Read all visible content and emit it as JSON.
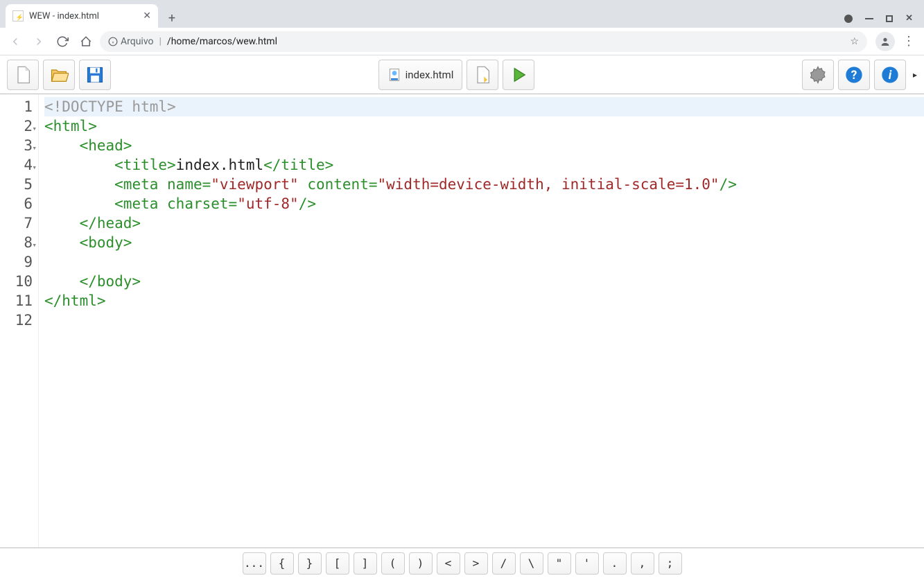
{
  "window": {
    "tab_title": "WEW - index.html"
  },
  "browser": {
    "address_label": "Arquivo",
    "address_path": "/home/marcos/wew.html"
  },
  "app": {
    "open_doc_label": "index.html"
  },
  "code": {
    "lines": [
      {
        "n": "1",
        "fold": false,
        "html": "<span class='t-decl'>&lt;!DOCTYPE html&gt;</span>",
        "current": true
      },
      {
        "n": "2",
        "fold": true,
        "html": "<span class='t-tag'>&lt;html&gt;</span>"
      },
      {
        "n": "3",
        "fold": true,
        "html": "    <span class='t-tag'>&lt;head&gt;</span>"
      },
      {
        "n": "4",
        "fold": true,
        "html": "        <span class='t-tag'>&lt;title&gt;</span><span class='t-text'>index.html</span><span class='t-tag'>&lt;/title&gt;</span>"
      },
      {
        "n": "5",
        "fold": false,
        "html": "        <span class='t-tag'>&lt;meta</span> <span class='t-attr'>name=</span><span class='t-string'>\"viewport\"</span> <span class='t-attr'>content=</span><span class='t-string'>\"width=device-width, initial-scale=1.0\"</span><span class='t-tag'>/&gt;</span>"
      },
      {
        "n": "6",
        "fold": false,
        "html": "        <span class='t-tag'>&lt;meta</span> <span class='t-attr'>charset=</span><span class='t-string'>\"utf-8\"</span><span class='t-tag'>/&gt;</span>"
      },
      {
        "n": "7",
        "fold": false,
        "html": "    <span class='t-tag'>&lt;/head&gt;</span>"
      },
      {
        "n": "8",
        "fold": true,
        "html": "    <span class='t-tag'>&lt;body&gt;</span>"
      },
      {
        "n": "9",
        "fold": false,
        "html": ""
      },
      {
        "n": "10",
        "fold": false,
        "html": "    <span class='t-tag'>&lt;/body&gt;</span>"
      },
      {
        "n": "11",
        "fold": false,
        "html": "<span class='t-tag'>&lt;/html&gt;</span>"
      },
      {
        "n": "12",
        "fold": false,
        "html": ""
      }
    ]
  },
  "charbar": [
    "...",
    "{",
    "}",
    "[",
    "]",
    "(",
    ")",
    "<",
    ">",
    "/",
    "\\",
    "\"",
    "'",
    ".",
    ",",
    ";"
  ]
}
